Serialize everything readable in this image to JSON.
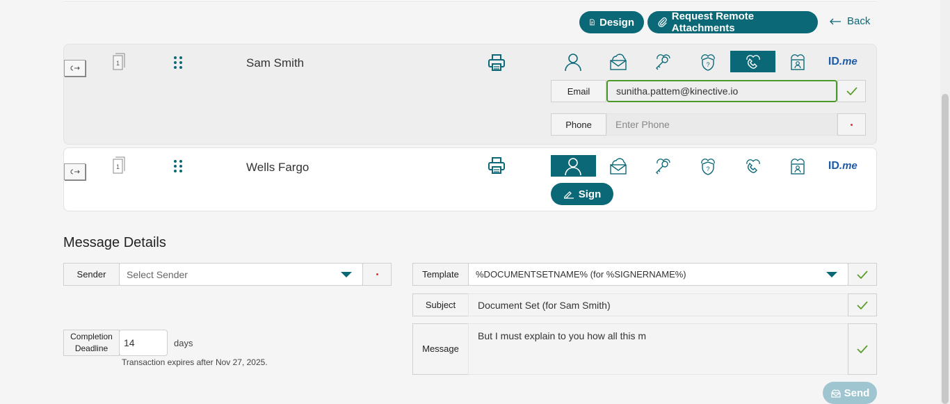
{
  "toolbar": {
    "design_label": "Design",
    "request_label": "Request Remote Attachments",
    "back_label": "Back"
  },
  "signers": [
    {
      "name": "Sam Smith",
      "doc_count": "1",
      "active_auth": "phone-icon",
      "email_label": "Email",
      "email_value": "sunitha.pattem@kinective.io",
      "phone_label": "Phone",
      "phone_placeholder": "Enter Phone"
    },
    {
      "name": "Wells Fargo",
      "doc_count": "1",
      "active_auth": "person-icon",
      "sign_label": "Sign"
    }
  ],
  "auth_methods": [
    "person-icon",
    "cloud-email-icon",
    "key-icon",
    "shield-question-icon",
    "phone-icon",
    "id-card-icon",
    "idme-logo"
  ],
  "idme": {
    "id": "ID",
    "me": ".me"
  },
  "message": {
    "title": "Message Details",
    "sender_label": "Sender",
    "sender_placeholder": "Select Sender",
    "template_label": "Template",
    "template_value": "%DOCUMENTSETNAME% (for %SIGNERNAME%)",
    "subject_label": "Subject",
    "subject_value": "Document Set (for Sam Smith)",
    "message_label": "Message",
    "message_value": "But I must explain to you how all this m",
    "deadline_label_1": "Completion",
    "deadline_label_2": "Deadline",
    "deadline_value": "14",
    "days_label": "days",
    "expire_text": "Transaction expires after Nov 27, 2025.",
    "send_label": "Send"
  },
  "colors": {
    "accent": "#0a6877",
    "check": "#5a9e2a",
    "email_border": "#4a9a2a",
    "send_disabled": "#9fc6d0"
  }
}
